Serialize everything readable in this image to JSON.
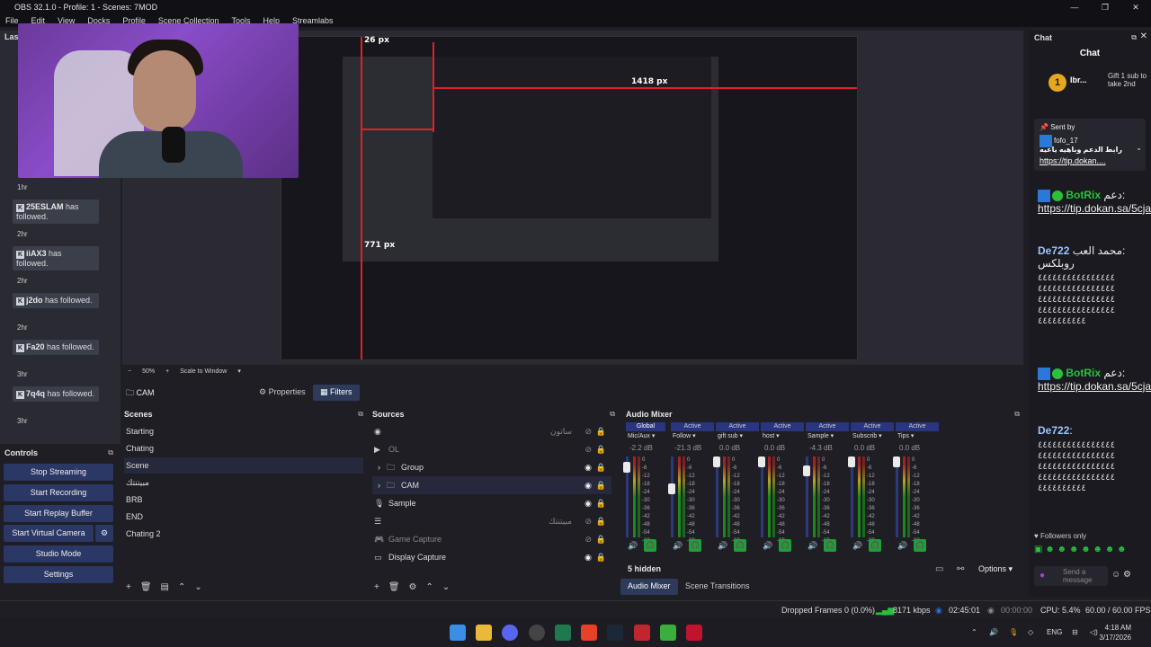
{
  "window": {
    "title": "OBS 32.1.0 - Profile: 1 - Scenes: 7MOD",
    "menu": [
      "File",
      "Edit",
      "View",
      "Docks",
      "Profile",
      "Scene Collection",
      "Tools",
      "Help",
      "Streamlabs"
    ]
  },
  "activity_feed": {
    "title": "Las",
    "items": [
      {
        "name": "25ESLAM",
        "text": "has followed.",
        "time": "2hr"
      },
      {
        "name": "iiAX3",
        "text": "has followed.",
        "time": "2hr"
      },
      {
        "name": "j2do",
        "text": "has followed.",
        "time": "2hr"
      },
      {
        "name": "Fa20",
        "text": "has followed.",
        "time": "3hr"
      },
      {
        "name": "7q4q",
        "text": "has followed.",
        "time": "3hr"
      }
    ],
    "first_time": "1hr"
  },
  "preview": {
    "measure_top": "26 px",
    "measure_right": "1418 px",
    "measure_left": "771 px"
  },
  "zoom": {
    "minus": "−",
    "percent": "50%",
    "plus": "+",
    "mode": "Scale to Window"
  },
  "source_bar": {
    "source_name": "CAM",
    "properties_label": "Properties",
    "filters_label": "Filters"
  },
  "scenes": {
    "title": "Scenes",
    "items": [
      "Starting",
      "Chating",
      "Scene",
      "ﻣﺒﻴﺘﻨﺘﻚ",
      "BRB",
      "END",
      "Chating 2"
    ],
    "selected_index": 2
  },
  "sources": {
    "title": "Sources",
    "items": [
      {
        "icon": "globe-icon",
        "label": "",
        "right_text": "ﺳﺎﺗﻮن",
        "visible": false
      },
      {
        "icon": "play-icon",
        "label": "OL",
        "right_text": "",
        "visible": false
      },
      {
        "icon": "folder-icon",
        "label": "Group",
        "right_text": "",
        "visible": true
      },
      {
        "icon": "folder-icon",
        "label": "CAM",
        "right_text": "",
        "visible": true
      },
      {
        "icon": "mic-icon",
        "label": "Sample",
        "right_text": "",
        "visible": true
      },
      {
        "icon": "list-icon",
        "label": "",
        "right_text": "ﻣﺒﻴﺘﻨﺘﻚ",
        "visible": false
      },
      {
        "icon": "gamepad-icon",
        "label": "Game Capture",
        "right_text": "",
        "visible": false
      },
      {
        "icon": "monitor-icon",
        "label": "Display Capture",
        "right_text": "",
        "visible": true
      }
    ],
    "selected_index": 3
  },
  "controls": {
    "title": "Controls",
    "buttons": [
      "Stop Streaming",
      "Start Recording",
      "Start Replay Buffer",
      "Start Virtual Camera",
      "Studio Mode",
      "Settings"
    ]
  },
  "mixer": {
    "title": "Audio Mixer",
    "global_label": "Global",
    "active_label": "Active",
    "channels": [
      {
        "name": "Mic/Aux",
        "db": "-2.2 dB",
        "level": 0.92
      },
      {
        "name": "Follow",
        "db": "-21.3 dB",
        "level": 0.63
      },
      {
        "name": "gift sub",
        "db": "0.0 dB",
        "level": 1.0
      },
      {
        "name": "host",
        "db": "0.0 dB",
        "level": 1.0
      },
      {
        "name": "Sample",
        "db": "-4.3 dB",
        "level": 0.88
      },
      {
        "name": "Subscrib",
        "db": "0.0 dB",
        "level": 1.0
      },
      {
        "name": "Tips",
        "db": "0.0 dB",
        "level": 1.0
      }
    ],
    "scale": [
      "0",
      "-6",
      "-12",
      "-18",
      "-24",
      "-30",
      "-36",
      "-42",
      "-48",
      "-54",
      "-60"
    ],
    "hidden_label": "5 hidden",
    "options_label": "Options",
    "tab_mixer": "Audio Mixer",
    "tab_transitions": "Scene Transitions"
  },
  "chat": {
    "title": "Chat",
    "header": "Chat",
    "gift_user": "Ibr...",
    "gift_text": "Gift 1 sub to take 2nd",
    "pinned_label": "Sent by",
    "pinned_user": "fofo_17",
    "pinned_text": "ﺭﺍﺑﻂ ﺍﻟﺪﻋﻢ ﻭﺑﺎﻫﻴﻪ ﻳﺎﻋﻴﻪ",
    "pinned_link": "https://tip.dokan....",
    "messages": [
      {
        "user": "BotRix",
        "text": "دعم:",
        "link": "https://tip.dokan.sa/5cja"
      },
      {
        "user": "De722",
        "text": "محمد العب:",
        "extra": "روبلكس"
      },
      {
        "user": "BotRix",
        "text": "دعم:",
        "link": "https://tip.dokan.sa/5cja"
      },
      {
        "user": "De722",
        "text": ":"
      }
    ],
    "followers_only": "Followers only",
    "send_placeholder": "Send a message"
  },
  "status": {
    "dropped": "Dropped Frames 0 (0.0%)",
    "kbps": "8171 kbps",
    "stream_time": "02:45:01",
    "rec_time": "00:00:00",
    "cpu": "CPU: 5.4%",
    "fps": "60.00 / 60.00 FPS"
  },
  "taskbar": {
    "lang": "ENG",
    "time": "4:18 AM",
    "date": "3/17/2026"
  },
  "colors": {
    "accent": "#2b3764",
    "active_blue": "#2a3580",
    "guide_red": "#e0202a",
    "meter_green": "#1a8b1a",
    "kick_green": "#27c23a"
  }
}
